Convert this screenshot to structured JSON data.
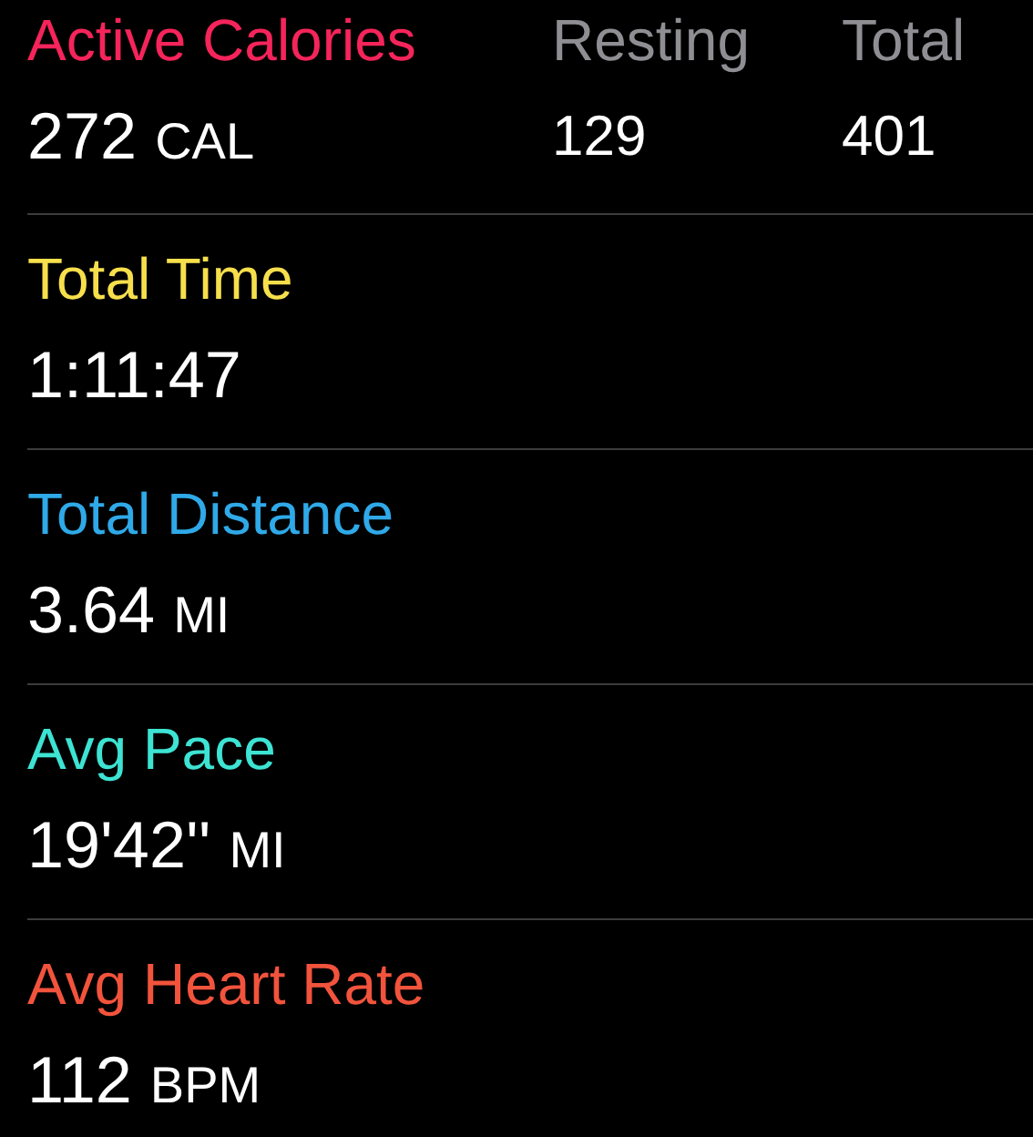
{
  "metrics": [
    {
      "kind": "split",
      "label": "Active Calories",
      "color": "#f5245a",
      "value": "272",
      "unit": "CAL",
      "extras": [
        {
          "label": "Resting",
          "value": "129"
        },
        {
          "label": "Total",
          "value": "401"
        }
      ]
    },
    {
      "kind": "single",
      "label": "Total Time",
      "color": "#f7df4c",
      "value": "1:11:47"
    },
    {
      "kind": "single",
      "label": "Total Distance",
      "color": "#2fa9e8",
      "value": "3.64",
      "unit": "MI"
    },
    {
      "kind": "single",
      "label": "Avg Pace",
      "color": "#3de3d3",
      "value": "19'42''",
      "unit": "MI"
    },
    {
      "kind": "single",
      "label": "Avg Heart Rate",
      "color": "#f2533c",
      "value": "112",
      "unit": "BPM"
    }
  ]
}
